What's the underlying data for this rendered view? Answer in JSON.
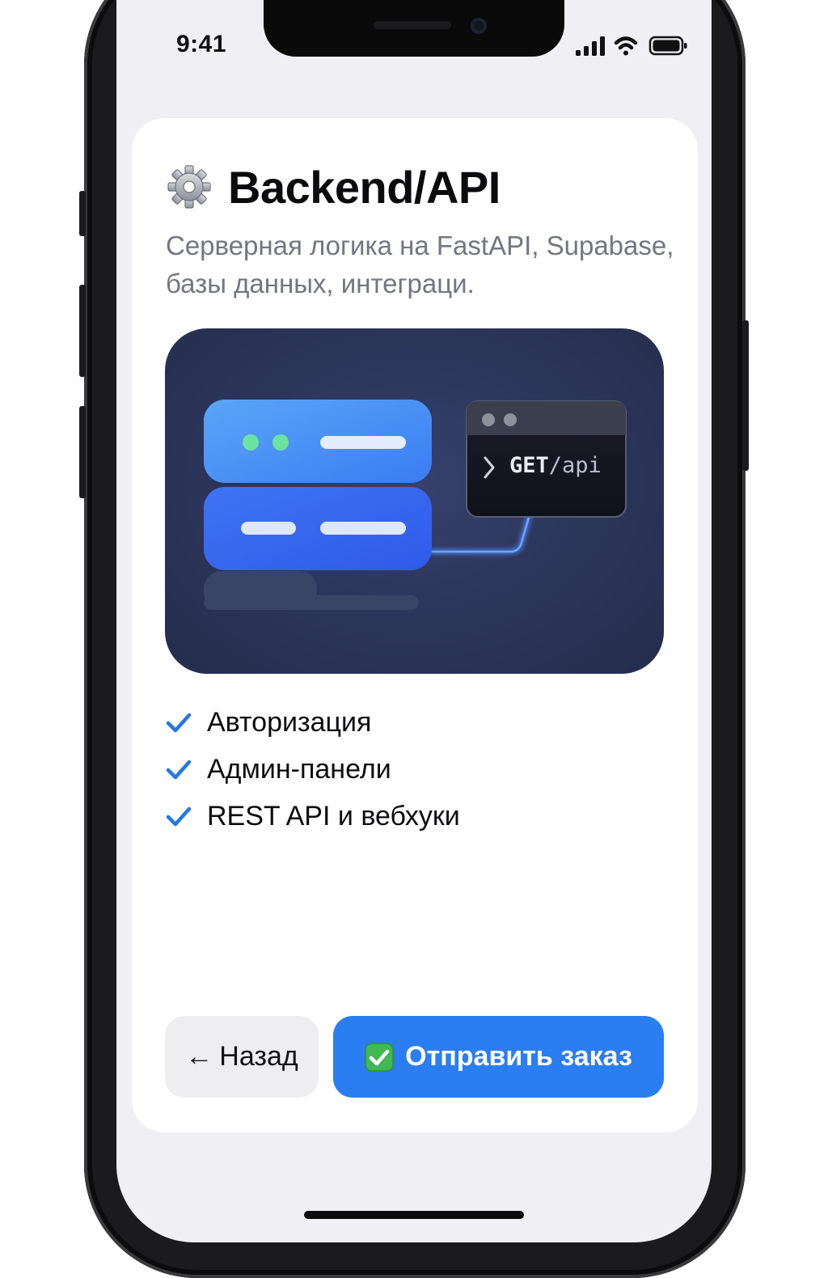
{
  "status_bar": {
    "time": "9:41",
    "icons": [
      "cellular-signal-icon",
      "wifi-icon",
      "battery-icon"
    ]
  },
  "card": {
    "icon": "gear-icon",
    "title": "Backend/API",
    "subtitle": "Серверная логика на FastAPI, Supabase, базы данных, интеграци."
  },
  "illustration": {
    "terminal_command": "GET",
    "terminal_path": "/api",
    "terminal_prompt": ">"
  },
  "features": [
    {
      "label": "Авторизация",
      "icon": "checkmark-icon"
    },
    {
      "label": "Админ-панели",
      "icon": "checkmark-icon"
    },
    {
      "label": "REST API и вебхуки",
      "icon": "checkmark-icon"
    }
  ],
  "actions": {
    "back_arrow": "←",
    "back_label": "Назад",
    "submit_label": "Отправить заказ",
    "submit_icon": "check-badge-icon"
  },
  "colors": {
    "accent": "#2b7df2",
    "check": "#2477e8",
    "illustration_bg": "#2d375d",
    "subtitle_text": "#737581"
  }
}
